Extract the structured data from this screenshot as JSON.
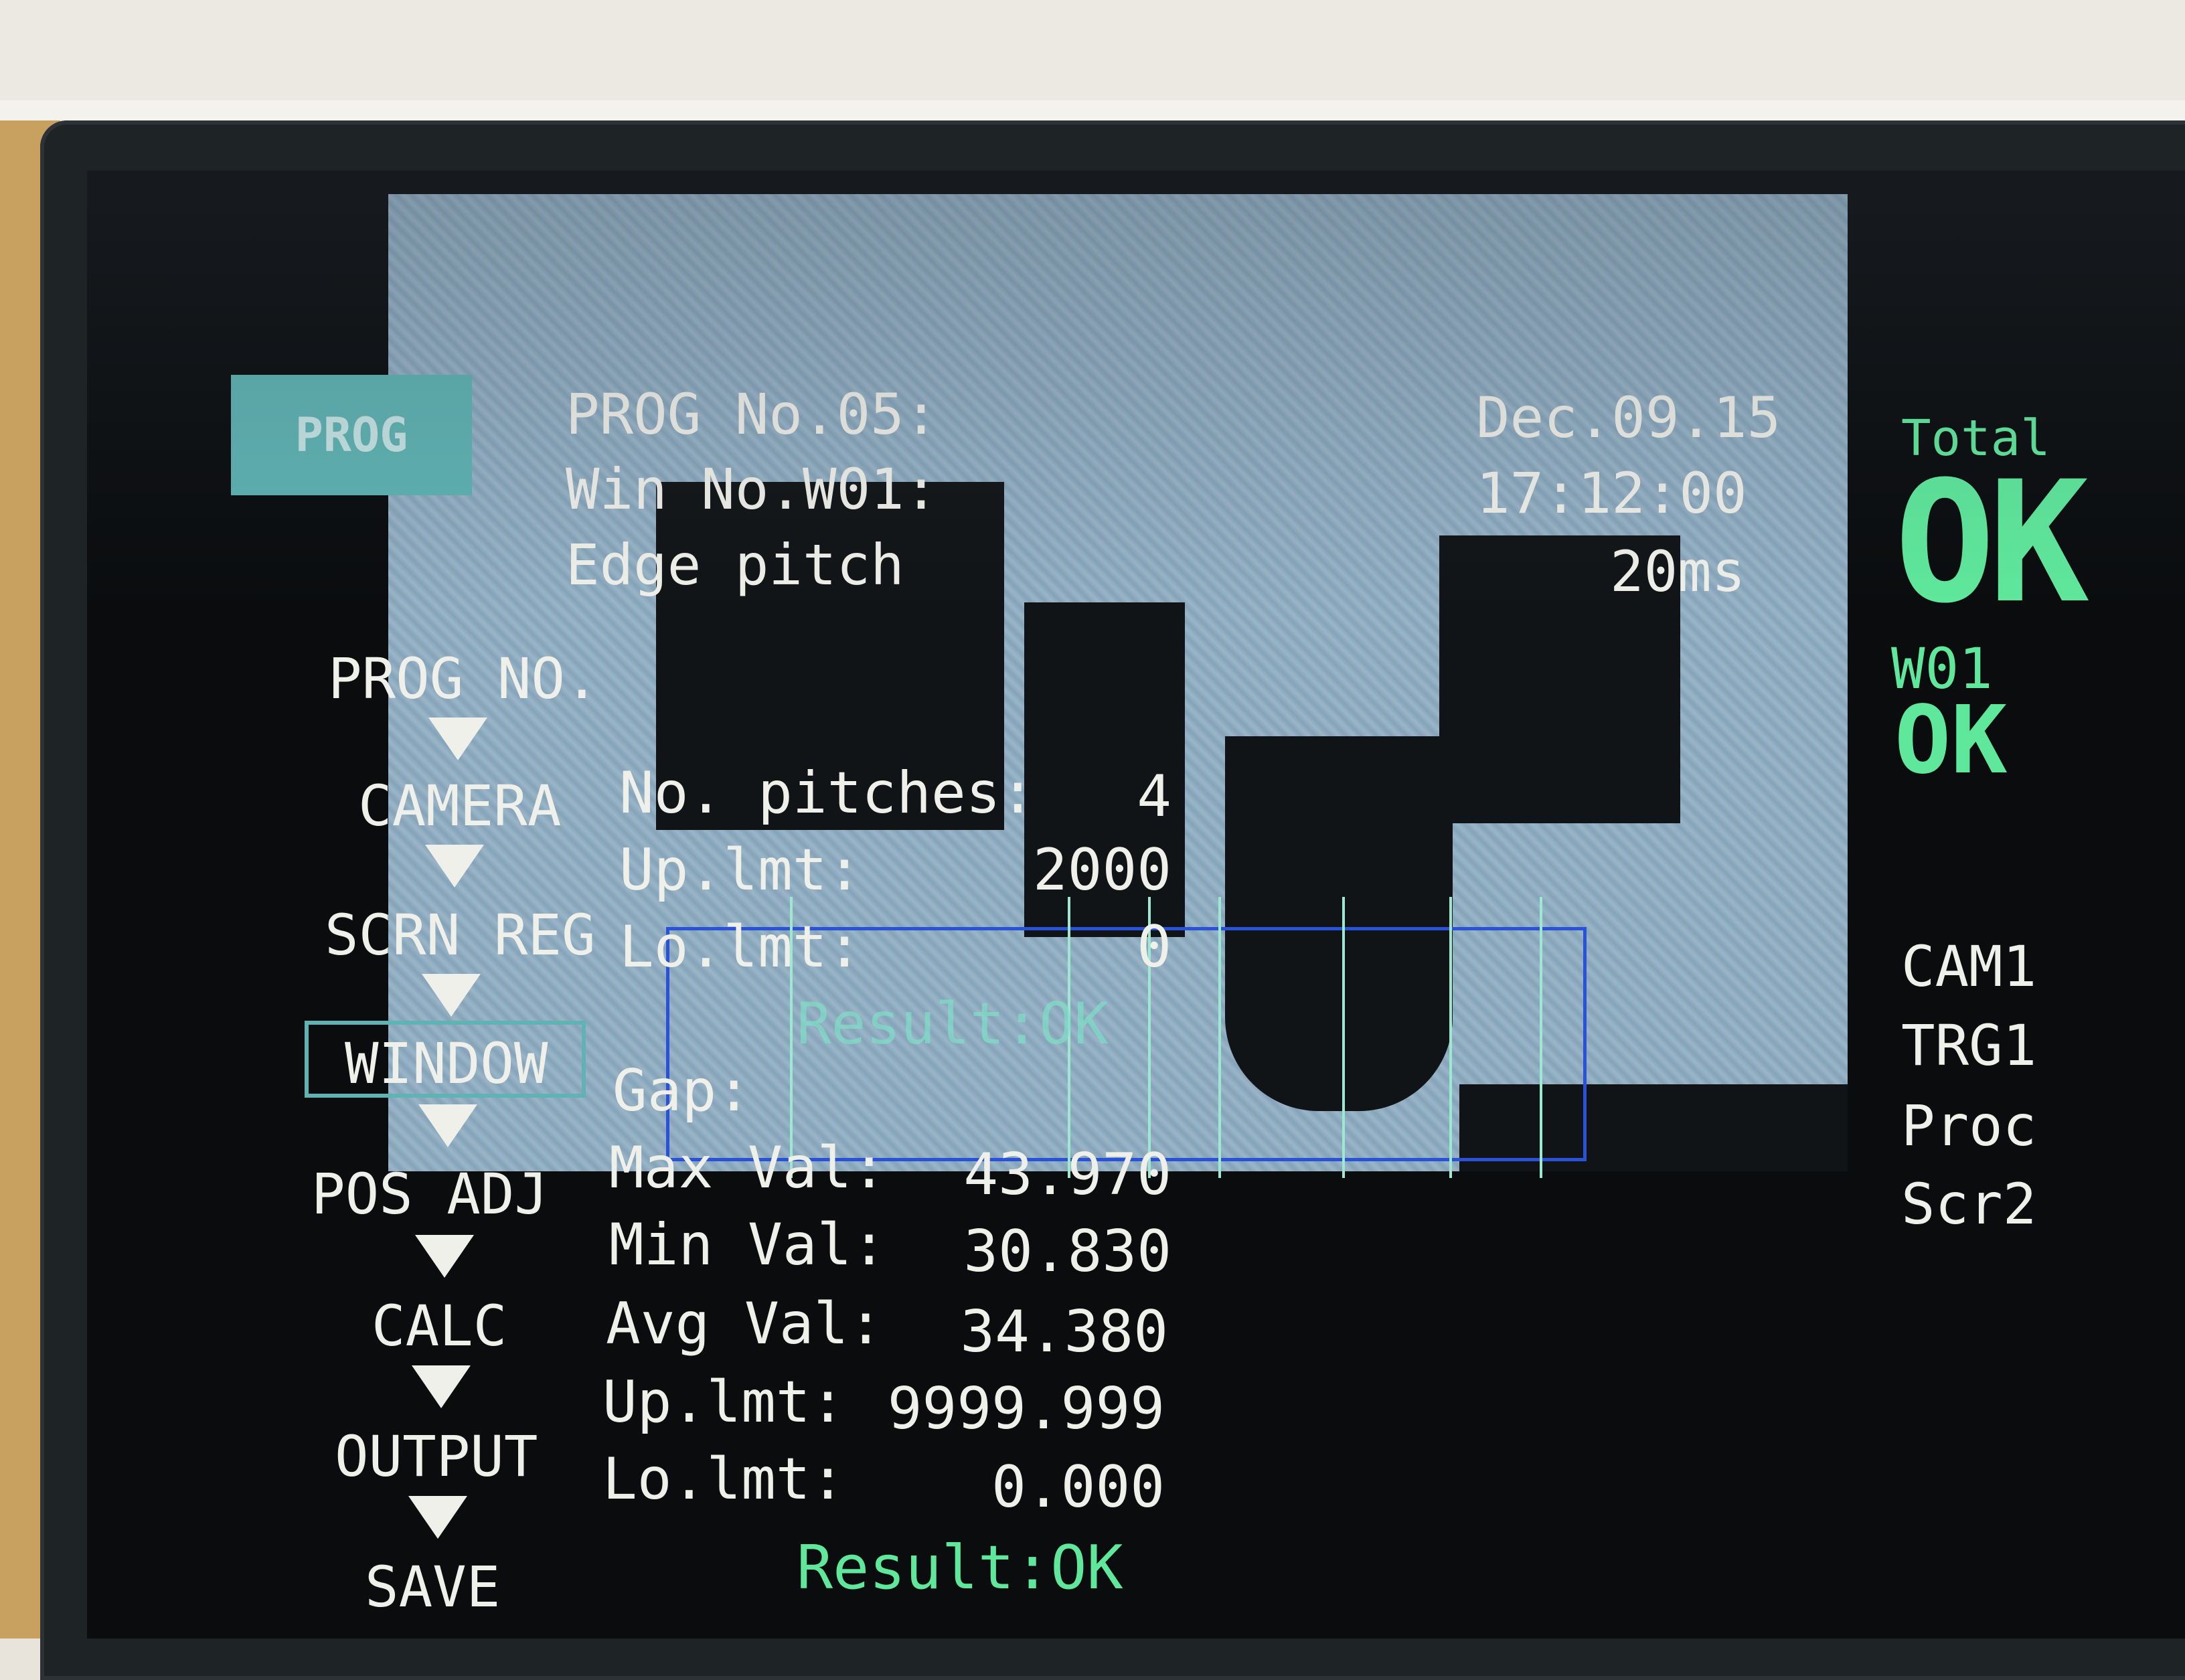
{
  "header": {
    "prog_tag": "PROG",
    "prog_no": "PROG No.05:",
    "win_no": "Win No.W01:",
    "mode": "Edge pitch",
    "date": "Dec.09.15",
    "time": "17:12:00",
    "duration": "20ms"
  },
  "status": {
    "total_label": "Total",
    "total_result": "OK",
    "window_label": "W01",
    "window_result": "OK",
    "camera": "CAM1",
    "trigger": "TRG1",
    "proc": "Proc",
    "screen": "Scr2"
  },
  "menu": {
    "items": [
      {
        "label": "PROG NO."
      },
      {
        "label": "CAMERA"
      },
      {
        "label": "SCRN REG"
      },
      {
        "label": "WINDOW"
      },
      {
        "label": "POS ADJ"
      },
      {
        "label": "CALC"
      },
      {
        "label": "OUTPUT"
      },
      {
        "label": "SAVE"
      }
    ],
    "selected": "WINDOW"
  },
  "pitch": {
    "count_label": "No. pitches:",
    "count_value": "4",
    "up_label": "Up.lmt:",
    "up_value": "2000",
    "lo_label": "Lo.lmt:",
    "lo_value": "0",
    "result": "Result:OK"
  },
  "gap": {
    "label": "Gap:",
    "max_label": "Max Val:",
    "max_value": "43.970",
    "min_label": "Min Val:",
    "min_value": "30.830",
    "avg_label": "Avg Val:",
    "avg_value": "34.380",
    "up_label": "Up.lmt:",
    "up_value": "9999.999",
    "lo_label": "Lo.lmt:",
    "lo_value": "0.000",
    "result": "Result:OK"
  }
}
